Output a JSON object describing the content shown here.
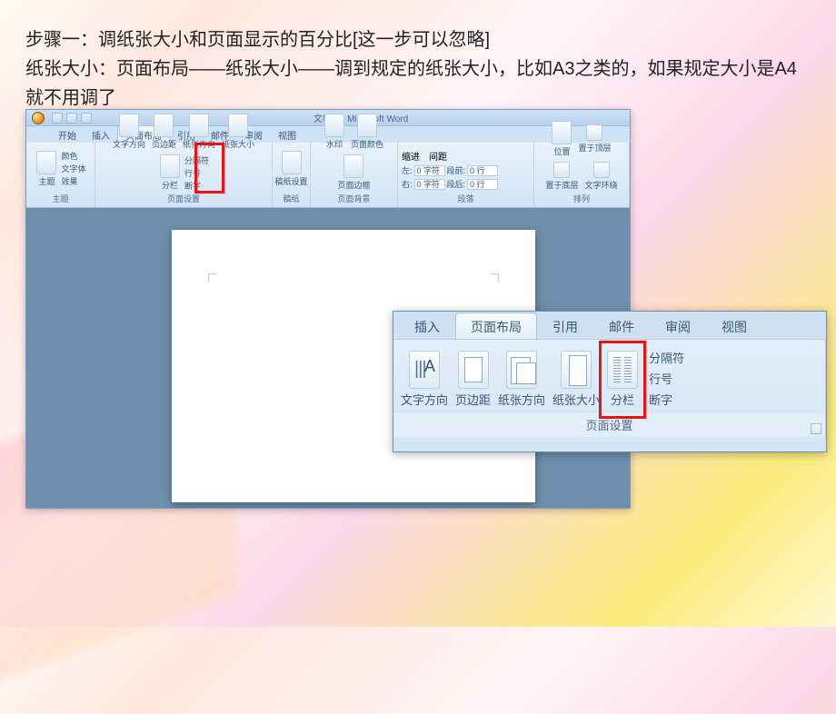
{
  "caption": {
    "line1": "步骤一：调纸张大小和页面显示的百分比[这一步可以忽略]",
    "line2": "纸张大小：页面布局——纸张大小——调到规定的纸张大小，比如A3之类的，如果规定大小是A4就不用调了"
  },
  "word": {
    "title": "文档 1 - Microsoft Word",
    "tabs": [
      "开始",
      "插入",
      "页面布局",
      "引用",
      "邮件",
      "审阅",
      "视图"
    ],
    "active_tab_index": 2,
    "groups": {
      "theme": {
        "label": "主题",
        "items": [
          "主题",
          "颜色",
          "文字体",
          "效果"
        ]
      },
      "page_setup": {
        "label": "页面设置",
        "items": [
          "文字方向",
          "页边距",
          "纸张方向",
          "纸张大小",
          "分栏"
        ],
        "side_items": [
          "分隔符",
          "行号",
          "断字"
        ]
      },
      "manuscript": {
        "label": "稿纸",
        "items": [
          "稿纸设置"
        ]
      },
      "page_bg": {
        "label": "页面背景",
        "items": [
          "水印",
          "页面颜色",
          "页面边框"
        ]
      },
      "paragraph": {
        "label": "段落",
        "indent_label": "缩进",
        "spacing_label": "间距",
        "left_label": "左:",
        "right_label": "右:",
        "before_label": "段前:",
        "after_label": "段后:",
        "zero_char": "0 字符",
        "zero_line": "0 行"
      },
      "arrange": {
        "label": "排列",
        "items": [
          "位置",
          "置于顶层",
          "置于底层",
          "文字环绕"
        ]
      }
    }
  },
  "zoom": {
    "tabs": [
      "插入",
      "页面布局",
      "引用",
      "邮件",
      "审阅",
      "视图"
    ],
    "active_tab_index": 1,
    "group_label": "页面设置",
    "items": [
      "文字方向",
      "页边距",
      "纸张方向",
      "纸张大小",
      "分栏"
    ],
    "side_items": [
      "分隔符",
      "行号",
      "断字"
    ]
  }
}
